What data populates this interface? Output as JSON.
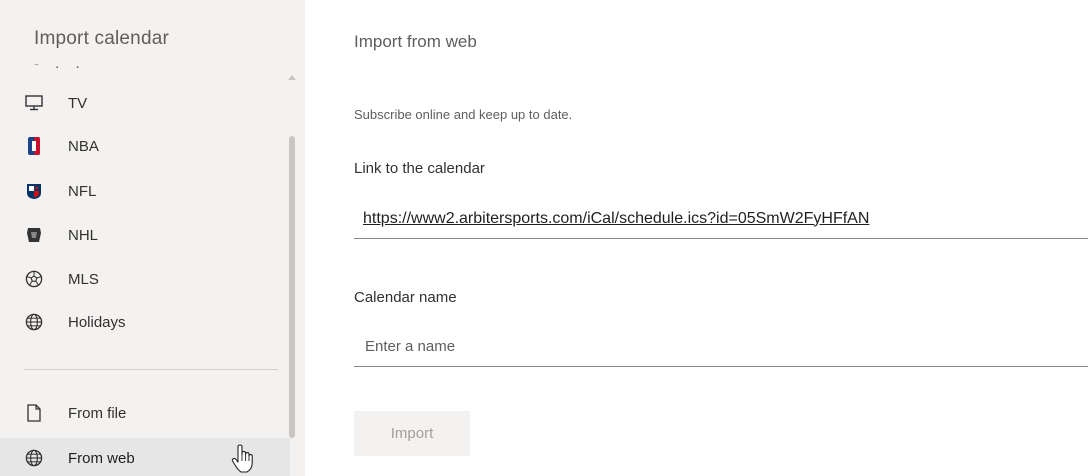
{
  "sidebar": {
    "title": "Import calendar",
    "items": [
      {
        "label": "TV",
        "icon": "tv-icon"
      },
      {
        "label": "NBA",
        "icon": "nba-logo-icon"
      },
      {
        "label": "NFL",
        "icon": "nfl-logo-icon"
      },
      {
        "label": "NHL",
        "icon": "nhl-logo-icon"
      },
      {
        "label": "MLS",
        "icon": "soccer-ball-icon"
      },
      {
        "label": "Holidays",
        "icon": "globe-icon"
      },
      {
        "label": "From file",
        "icon": "file-add-icon"
      },
      {
        "label": "From web",
        "icon": "globe-icon",
        "selected": true
      }
    ]
  },
  "main": {
    "title": "Import from web",
    "subtitle": "Subscribe online and keep up to date.",
    "link_label": "Link to the calendar",
    "link_value": "https://www2.arbitersports.com/iCal/schedule.ics?id=05SmW2FyHFfAN",
    "name_label": "Calendar name",
    "name_placeholder": "Enter a name",
    "name_value": "",
    "import_button": "Import"
  },
  "colors": {
    "sidebar_bg": "#f3f2f1",
    "selected_bg": "#e6e6e6",
    "text": "#323130",
    "muted_text": "#605e5c",
    "disabled_button_text": "#a19f9d"
  }
}
